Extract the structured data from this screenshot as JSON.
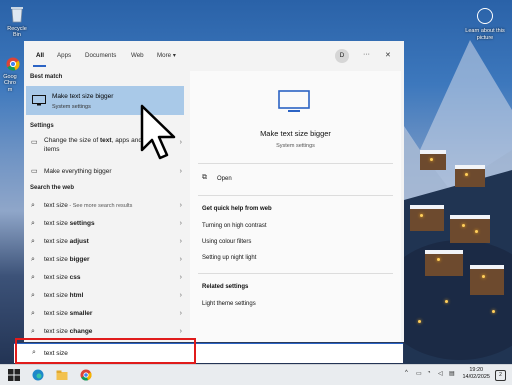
{
  "desktop": {
    "recycle_bin_label": "Recycle Bin",
    "chrome_label_partial": "Goog Chrom",
    "learn_label": "Learn about this picture"
  },
  "search_panel": {
    "tabs": [
      {
        "label": "All"
      },
      {
        "label": "Apps"
      },
      {
        "label": "Documents"
      },
      {
        "label": "Web"
      },
      {
        "label": "More ▾"
      }
    ],
    "avatar_initial": "D",
    "more_options": "···",
    "close": "✕",
    "best_match_heading": "Best match",
    "best_match": {
      "title": "Make text size bigger",
      "subtitle": "System settings"
    },
    "settings_heading": "Settings",
    "settings_items": [
      {
        "pre": "Change the size of ",
        "bold": "text",
        "post": ", apps and other items"
      },
      {
        "pre": "Make everything bigger",
        "bold": "",
        "post": ""
      }
    ],
    "web_heading": "Search the web",
    "web_items": [
      {
        "base": "text size",
        "suffix": "",
        "note": " - See more search results"
      },
      {
        "base": "text size ",
        "suffix": "settings",
        "note": ""
      },
      {
        "base": "text size ",
        "suffix": "adjust",
        "note": ""
      },
      {
        "base": "text size ",
        "suffix": "bigger",
        "note": ""
      },
      {
        "base": "text size ",
        "suffix": "css",
        "note": ""
      },
      {
        "base": "text size ",
        "suffix": "html",
        "note": ""
      },
      {
        "base": "text size ",
        "suffix": "smaller",
        "note": ""
      },
      {
        "base": "text size ",
        "suffix": "change",
        "note": ""
      }
    ],
    "preview": {
      "title": "Make text size bigger",
      "subtitle": "System settings",
      "open_label": "Open",
      "quick_help_heading": "Get quick help from web",
      "quick_help": [
        "Turning on high contrast",
        "Using colour filters",
        "Setting up night light"
      ],
      "related_heading": "Related settings",
      "related": [
        "Light theme settings"
      ]
    },
    "search_query": "text size"
  },
  "taskbar": {
    "time": "19:20",
    "date": "14/02/2025",
    "notification_count": "2",
    "tray_chevron": "^"
  },
  "colors": {
    "accent": "#2b63c4",
    "best_match_bg": "#a9c9e8",
    "highlight_border": "#e01b1b"
  }
}
